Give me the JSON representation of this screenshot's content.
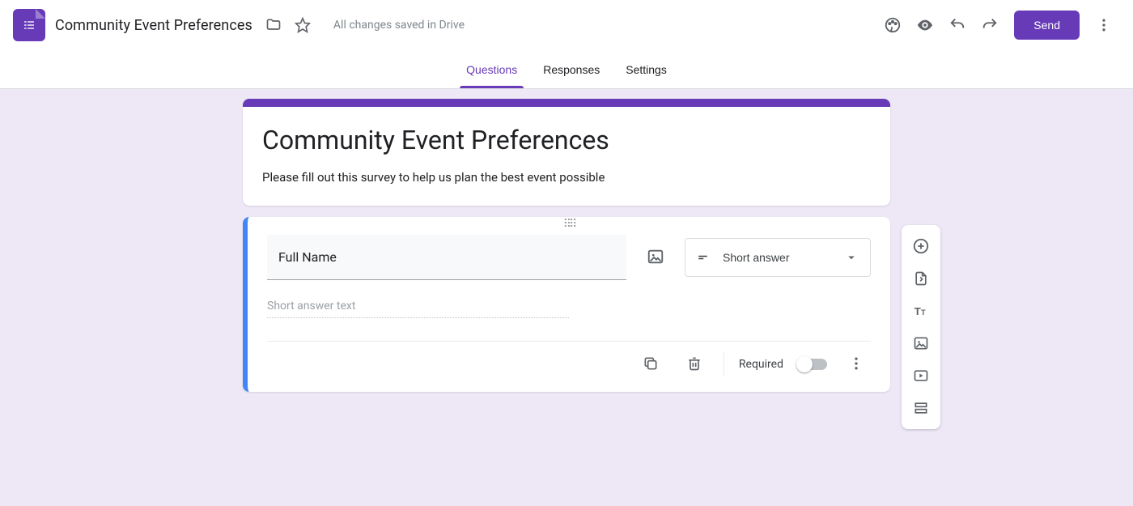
{
  "header": {
    "doc_title": "Community Event Preferences",
    "saved_status": "All changes saved in Drive",
    "send_label": "Send"
  },
  "tabs": {
    "questions": "Questions",
    "responses": "Responses",
    "settings": "Settings",
    "active": "questions"
  },
  "form": {
    "title": "Community Event Preferences",
    "description": "Please fill out this survey to help us plan the best event possible"
  },
  "question": {
    "title": "Full Name",
    "type_label": "Short answer",
    "answer_placeholder": "Short answer text",
    "required_label": "Required",
    "required": false
  },
  "icons": {
    "folder": "folder",
    "star": "star",
    "palette": "palette",
    "preview": "eye",
    "undo": "undo",
    "redo": "redo",
    "more": "more-vert",
    "image": "image",
    "short_answer": "short-text",
    "dropdown": "arrow-drop-down",
    "duplicate": "copy",
    "delete": "trash",
    "add_question": "plus-circle",
    "import": "import-file",
    "add_title": "text-Tt",
    "add_image": "image",
    "add_video": "play-box",
    "add_section": "section-rows"
  }
}
